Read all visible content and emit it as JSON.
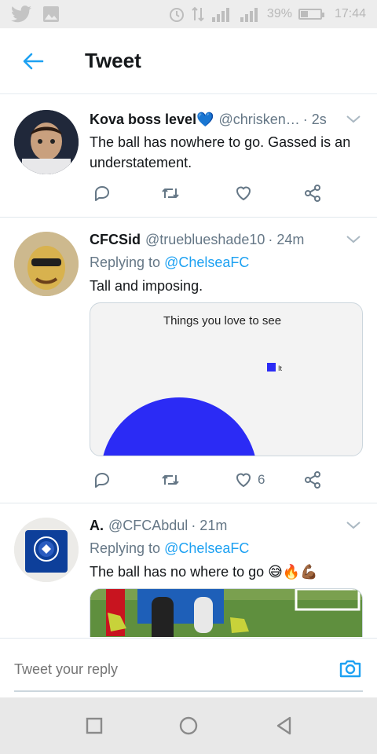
{
  "status_bar": {
    "battery": "39%",
    "time": "17:44",
    "battery_level": 0.39
  },
  "app_bar": {
    "title": "Tweet"
  },
  "tweets": [
    {
      "name": "Kova boss level💙",
      "handle": "@chrisken…",
      "time": "· 2s",
      "text": "The ball has nowhere to go. Gassed is an understatement."
    },
    {
      "name": "CFCSid",
      "handle": "@trueblueshade10",
      "time": "· 24m",
      "replying_prefix": "Replying to ",
      "replying_to": "@ChelseaFC",
      "text": "Tall and imposing.",
      "like_count": "6",
      "media": {
        "chart_title": "Things you love to see",
        "legend_label": "It"
      }
    },
    {
      "name": "A.",
      "handle": "@CFCAbdul",
      "time": "· 21m",
      "replying_prefix": "Replying to ",
      "replying_to": "@ChelseaFC",
      "text": "The ball has no where to go 😅🔥💪🏾"
    }
  ],
  "reply_box": {
    "placeholder": "Tweet your reply"
  },
  "colors": {
    "accent": "#1da1f2",
    "chart_blue": "#2b2bf5",
    "secondary_text": "#657786"
  },
  "chart_data": {
    "type": "pie",
    "title": "Things you love to see",
    "labels": [
      "It"
    ],
    "values": [
      100
    ],
    "legend": "right"
  }
}
